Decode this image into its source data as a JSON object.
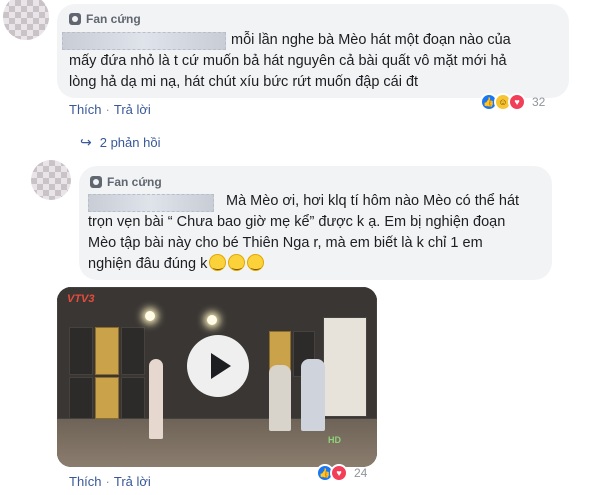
{
  "comments": [
    {
      "badge": "Fan cứng",
      "lines": [
        "mỗi lần nghe bà Mèo hát một đoạn nào của",
        "mấy đứa nhỏ là t cứ muốn bả hát nguyên cả bài quất vô mặt mới hả",
        "lòng hả dạ mi nạ, hát chút xíu bức rứt muốn đập cái đt"
      ],
      "like_label": "Thích",
      "reply_label": "Trả lời",
      "reactions": [
        "like-icon",
        "haha-icon",
        "love-icon"
      ],
      "reaction_count": "32",
      "replies_label": "2 phản hồi"
    },
    {
      "badge": "Fan cứng",
      "lines": [
        "Mà Mèo ơi, hơi klq tí hôm nào Mèo có thể hát",
        "trọn vẹn bài “ Chưa bao giờ mẹ kể” được k ạ. Em bị nghiện đoạn",
        "Mèo tập bài này cho bé Thiên Nga r, mà em biết là k chỉ 1 em",
        "nghiện đâu đúng k"
      ],
      "emoji_count_label": "😊😊😊",
      "like_label": "Thích",
      "reply_label": "Trả lời",
      "reactions": [
        "like-icon",
        "love-icon"
      ],
      "reaction_count": "24",
      "video": {
        "channel_logo": "VTV3",
        "hd_badge": "HD"
      }
    }
  ],
  "colors": {
    "link": "#385898",
    "bubble": "#f2f3f5",
    "like": "#1877f2",
    "love": "#f33e58",
    "haha": "#f7c531"
  }
}
